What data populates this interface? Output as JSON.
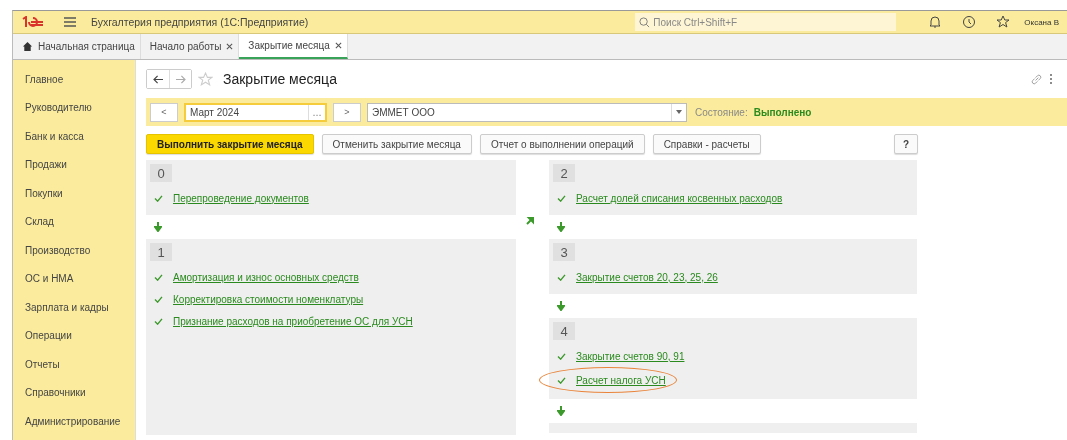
{
  "app_title": "Бухгалтерия предприятия  (1С:Предприятие)",
  "search": {
    "placeholder": "Поиск Ctrl+Shift+F"
  },
  "user": "Оксана В",
  "tabs": [
    {
      "label": "Начальная страница",
      "kind": "home",
      "selected": false
    },
    {
      "label": "Начало работы",
      "kind": "closable",
      "selected": false
    },
    {
      "label": "Закрытие месяца",
      "kind": "closable",
      "selected": true
    }
  ],
  "sidebar": {
    "items": [
      "Главное",
      "Руководителю",
      "Банк и касса",
      "Продажи",
      "Покупки",
      "Склад",
      "Производство",
      "ОС и НМА",
      "Зарплата и кадры",
      "Операции",
      "Отчеты",
      "Справочники",
      "Администрирование"
    ]
  },
  "page_title": "Закрытие месяца",
  "period": {
    "prev": "<",
    "value": "Март 2024",
    "more": "...",
    "next": ">"
  },
  "organization": "ЭММЕТ ООО",
  "state_label": "Состояние:",
  "state_value": "Выполнено",
  "buttons": [
    {
      "label": "Выполнить закрытие месяца",
      "primary": true
    },
    {
      "label": "Отменить закрытие месяца",
      "primary": false
    },
    {
      "label": "Отчет о выполнении операций",
      "primary": false
    },
    {
      "label": "Справки - расчеты",
      "primary": false
    }
  ],
  "help": "?",
  "columns": [
    [
      {
        "number": "0",
        "items": [
          {
            "label": "Перепроведение документов",
            "done": true,
            "highlighted": false
          }
        ],
        "arrow_after": true
      },
      {
        "number": "1",
        "items": [
          {
            "label": "Амортизация и износ основных средств",
            "done": true,
            "highlighted": false
          },
          {
            "label": "Корректировка стоимости номенклатуры",
            "done": true,
            "highlighted": false
          },
          {
            "label": "Признание расходов на приобретение ОС для УСН",
            "done": true,
            "highlighted": false
          }
        ],
        "arrow_after": false
      }
    ],
    [
      {
        "number": "2",
        "items": [
          {
            "label": "Расчет долей списания косвенных расходов",
            "done": true,
            "highlighted": false
          }
        ],
        "arrow_after": true
      },
      {
        "number": "3",
        "items": [
          {
            "label": "Закрытие счетов 20, 23, 25, 26",
            "done": true,
            "highlighted": false
          }
        ],
        "arrow_after": true
      },
      {
        "number": "4",
        "items": [
          {
            "label": "Закрытие счетов 90, 91",
            "done": true,
            "highlighted": false
          },
          {
            "label": "Расчет налога УСН",
            "done": true,
            "highlighted": true
          }
        ],
        "arrow_after": true
      }
    ]
  ]
}
